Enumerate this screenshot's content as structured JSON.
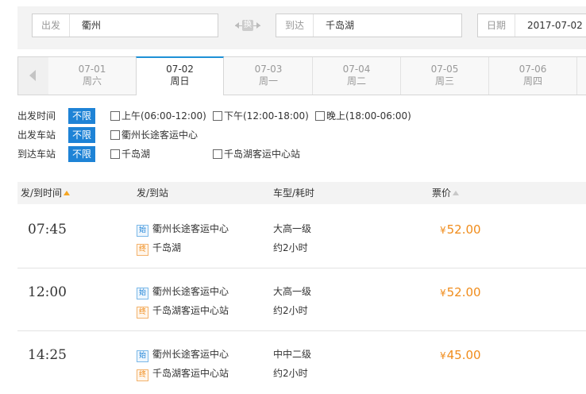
{
  "search": {
    "from_label": "出发",
    "from_value": "衢州",
    "swap_label": "换",
    "to_label": "到达",
    "to_value": "千岛湖",
    "date_label": "日期",
    "date_value": "2017-07-02"
  },
  "date_tabs": [
    {
      "date": "07-01",
      "weekday": "周六",
      "active": false
    },
    {
      "date": "07-02",
      "weekday": "周日",
      "active": true
    },
    {
      "date": "07-03",
      "weekday": "周一",
      "active": false
    },
    {
      "date": "07-04",
      "weekday": "周二",
      "active": false
    },
    {
      "date": "07-05",
      "weekday": "周三",
      "active": false
    },
    {
      "date": "07-06",
      "weekday": "周四",
      "active": false
    }
  ],
  "filters": {
    "depart_time": {
      "label": "出发时间",
      "all": "不限",
      "options": [
        "上午(06:00-12:00)",
        "下午(12:00-18:00)",
        "晚上(18:00-06:00)"
      ]
    },
    "depart_station": {
      "label": "出发车站",
      "all": "不限",
      "options": [
        "衢州长途客运中心"
      ]
    },
    "arrive_station": {
      "label": "到达车站",
      "all": "不限",
      "options": [
        "千岛湖",
        "千岛湖客运中心站"
      ]
    }
  },
  "table": {
    "headers": {
      "time": "发/到时间",
      "station": "发/到站",
      "type": "车型/耗时",
      "price": "票价"
    },
    "badge_start": "始",
    "badge_end": "终",
    "currency": "¥",
    "rows": [
      {
        "time": "07:45",
        "from": "衢州长途客运中心",
        "to": "千岛湖",
        "type": "大高一级",
        "duration": "约2小时",
        "price": "52.00"
      },
      {
        "time": "12:00",
        "from": "衢州长途客运中心",
        "to": "千岛湖客运中心站",
        "type": "大高一级",
        "duration": "约2小时",
        "price": "52.00"
      },
      {
        "time": "14:25",
        "from": "衢州长途客运中心",
        "to": "千岛湖客运中心站",
        "type": "中中二级",
        "duration": "约2小时",
        "price": "45.00"
      }
    ]
  },
  "colors": {
    "accent_blue": "#1e83d6",
    "price_orange": "#f08c1b"
  }
}
